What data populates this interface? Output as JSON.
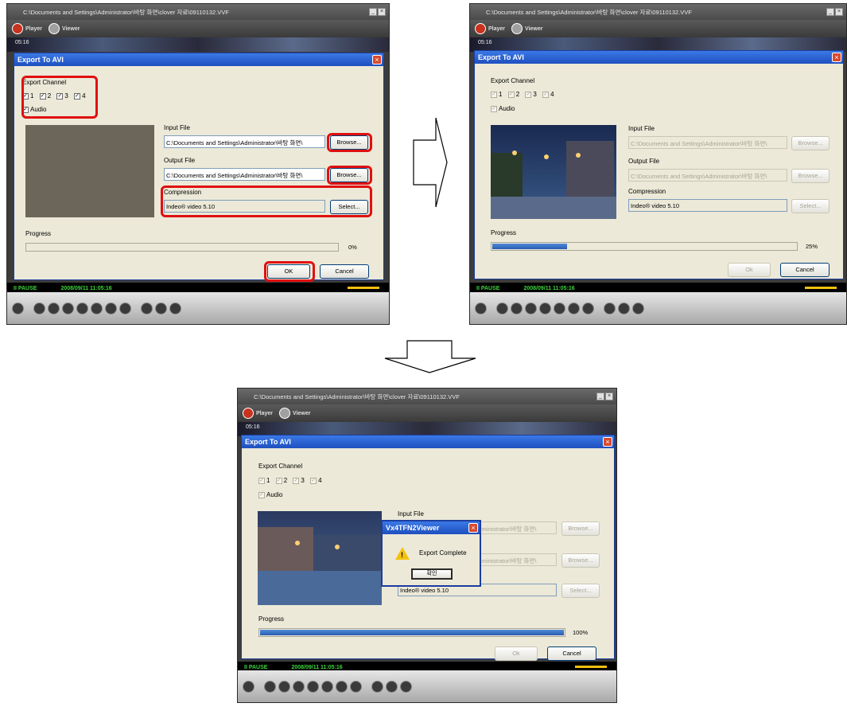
{
  "window": {
    "title": "C:\\Documents and Settings\\Administrator\\바탕 화면\\clover 자료\\09110132.VVF",
    "player_tab": "Player",
    "viewer_tab": "Viewer",
    "ticker_left": "05:16",
    "ticker_right": "2008/09/11 11:05:16"
  },
  "status": {
    "state": "PAUSE",
    "timestamp": "2008/09/11 11:05:16"
  },
  "dialog": {
    "title": "Export To AVI",
    "export_channel_label": "Export Channel",
    "channels": [
      "1",
      "2",
      "3",
      "4"
    ],
    "audio_label": "Audio",
    "input_file_label": "Input File",
    "input_file_value": "C:\\Documents and Settings\\Administrator\\바탕 화면\\",
    "output_file_label": "Output File",
    "output_file_value": "C:\\Documents and Settings\\Administrator\\바탕 화면\\",
    "browse_label": "Browse...",
    "compression_label": "Compression",
    "compression_value": "Indeo® video 5.10",
    "select_label": "Select...",
    "progress_label": "Progress",
    "ok_label": "OK",
    "ok_label_disabled": "Ok",
    "cancel_label": "Cancel"
  },
  "steps": [
    {
      "progress_text": "0%",
      "progress_fraction": 0.0
    },
    {
      "progress_text": "25%",
      "progress_fraction": 0.25
    },
    {
      "progress_text": "100%",
      "progress_fraction": 1.0
    }
  ],
  "message_box": {
    "title": "Vx4TFN2Viewer",
    "text": "Export Complete",
    "ok_label": "확인"
  },
  "colors": {
    "highlight": "#e01010",
    "dialog_title": "#1f4fbf",
    "progress_fill": "#2b5cb0",
    "status_text": "#3cd43c"
  }
}
